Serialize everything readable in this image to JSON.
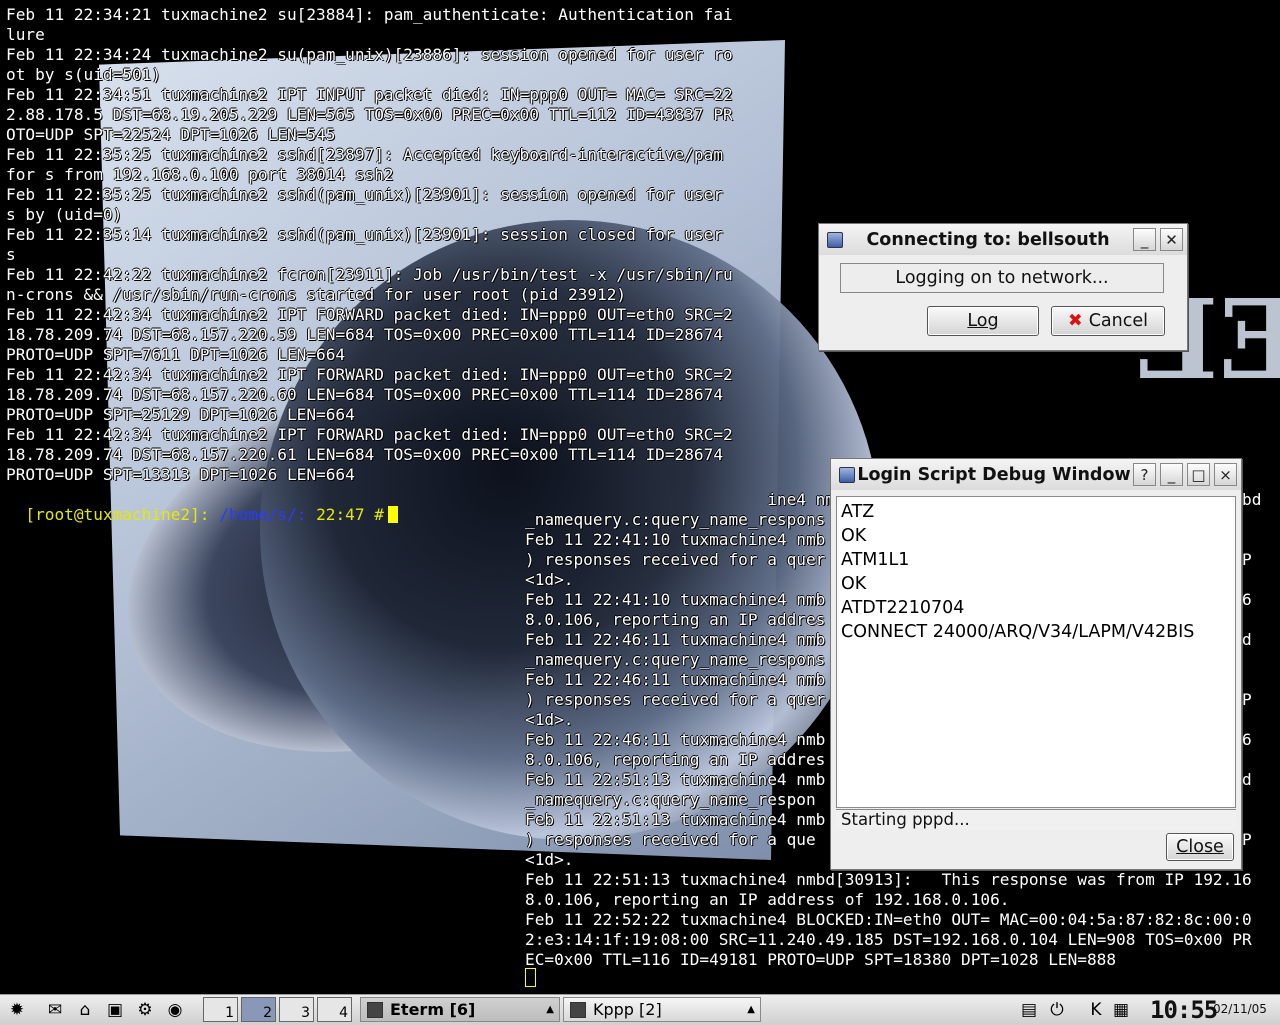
{
  "terminal_left": {
    "lines": [
      "Feb 11 22:34:21 tuxmachine2 su[23884]: pam_authenticate: Authentication fai",
      "lure",
      "Feb 11 22:34:24 tuxmachine2 su(pam_unix)[23886]: session opened for user ro",
      "ot by s(uid=501)",
      "Feb 11 22:34:51 tuxmachine2 IPT INPUT packet died: IN=ppp0 OUT= MAC= SRC=22",
      "2.88.178.5 DST=68.19.205.229 LEN=565 TOS=0x00 PREC=0x00 TTL=112 ID=43837 PR",
      "OTO=UDP SPT=22524 DPT=1026 LEN=545",
      "Feb 11 22:35:25 tuxmachine2 sshd[23897]: Accepted keyboard-interactive/pam",
      "for s from 192.168.0.100 port 38014 ssh2",
      "Feb 11 22:35:25 tuxmachine2 sshd(pam_unix)[23901]: session opened for user",
      "s by (uid=0)",
      "Feb 11 22:35:14 tuxmachine2 sshd(pam_unix)[23901]: session closed for user",
      "s",
      "Feb 11 22:42:22 tuxmachine2 fcron[23911]: Job /usr/bin/test -x /usr/sbin/ru",
      "n-crons && /usr/sbin/run-crons started for user root (pid 23912)",
      "Feb 11 22:42:34 tuxmachine2 IPT FORWARD packet died: IN=ppp0 OUT=eth0 SRC=2",
      "18.78.209.74 DST=68.157.220.59 LEN=684 TOS=0x00 PREC=0x00 TTL=114 ID=28674",
      "PROTO=UDP SPT=7611 DPT=1026 LEN=664",
      "Feb 11 22:42:34 tuxmachine2 IPT FORWARD packet died: IN=ppp0 OUT=eth0 SRC=2",
      "18.78.209.74 DST=68.157.220.60 LEN=684 TOS=0x00 PREC=0x00 TTL=114 ID=28674",
      "PROTO=UDP SPT=25129 DPT=1026 LEN=664",
      "Feb 11 22:42:34 tuxmachine2 IPT FORWARD packet died: IN=ppp0 OUT=eth0 SRC=2",
      "18.78.209.74 DST=68.157.220.61 LEN=684 TOS=0x00 PREC=0x00 TTL=114 ID=28674",
      "PROTO=UDP SPT=13313 DPT=1026 LEN=664"
    ],
    "prompt_user": "[root@tuxmachine2]:",
    "prompt_path": " /home/s/:",
    "prompt_time": " 22:47 #"
  },
  "terminal_right": {
    "lines": [
      "                         ine4 nmbd                                      nmbd",
      "_namequery.c:query_name_respons",
      "Feb 11 22:41:10 tuxmachine4 nmb                                         (2",
      ") responses received for a quer                                        ROUP",
      "<1d>.",
      "Feb 11 22:41:10 tuxmachine4 nmb                                        2.16",
      "8.0.106, reporting an IP addres",
      "Feb 11 22:46:11 tuxmachine4 nmb                                        nmbd",
      "_namequery.c:query_name_respons",
      "Feb 11 22:46:11 tuxmachine4 nmb                                         (2",
      ") responses received for a quer                                        ROUP",
      "<1d>.",
      "Feb 11 22:46:11 tuxmachine4 nmb                                        2.16",
      "8.0.106, reporting an IP addres",
      "Feb 11 22:51:13 tuxmachine4 nmb                                        nmbd",
      "_namequery.c:query_name_respon",
      "Feb 11 22:51:13 tuxmachine4 nmb                                         (2",
      ") responses received for a que                                         ROUP",
      "<1d>.",
      "Feb 11 22:51:13 tuxmachine4 nmbd[30913]:   This response was from IP 192.16",
      "8.0.106, reporting an IP address of 192.168.0.106.",
      "Feb 11 22:52:22 tuxmachine4 BLOCKED:IN=eth0 OUT= MAC=00:04:5a:87:82:8c:00:0",
      "2:e3:14:1f:19:08:00 SRC=11.240.49.185 DST=192.168.0.104 LEN=908 TOS=0x00 PR",
      "EC=0x00 TTL=116 ID=49181 PROTO=UDP SPT=18380 DPT=1028 LEN=888"
    ]
  },
  "connect_dialog": {
    "title": "Connecting to: bellsouth",
    "status": "Logging on to network...",
    "log_button": "Log",
    "cancel_button": "Cancel"
  },
  "debug_window": {
    "title": "Login Script Debug Window",
    "log_lines": [
      "ATZ",
      "OK",
      "ATM1L1",
      "OK",
      "ATDT2210704",
      "CONNECT 24000/ARQ/V34/LAPM/V42BIS"
    ],
    "status": "Starting pppd...",
    "close_button": "Close",
    "help_button": "?",
    "minimize_button": "_",
    "maximize_button": "□",
    "close_x": "×"
  },
  "taskbar": {
    "desktops": [
      "1",
      "2",
      "3",
      "4"
    ],
    "active_desktop": 2,
    "tasks": [
      {
        "label": "Eterm [6]",
        "active": true
      },
      {
        "label": "Kppp [2]",
        "active": false
      }
    ],
    "clock": "10:55",
    "date": "02/11/05"
  },
  "colors": {
    "prompt_user": "#e8e800",
    "prompt_path": "#2a3aff",
    "cursor": "#ffff00",
    "dialog_bg": "#eeeeee",
    "cancel_x": "#dd1111"
  }
}
